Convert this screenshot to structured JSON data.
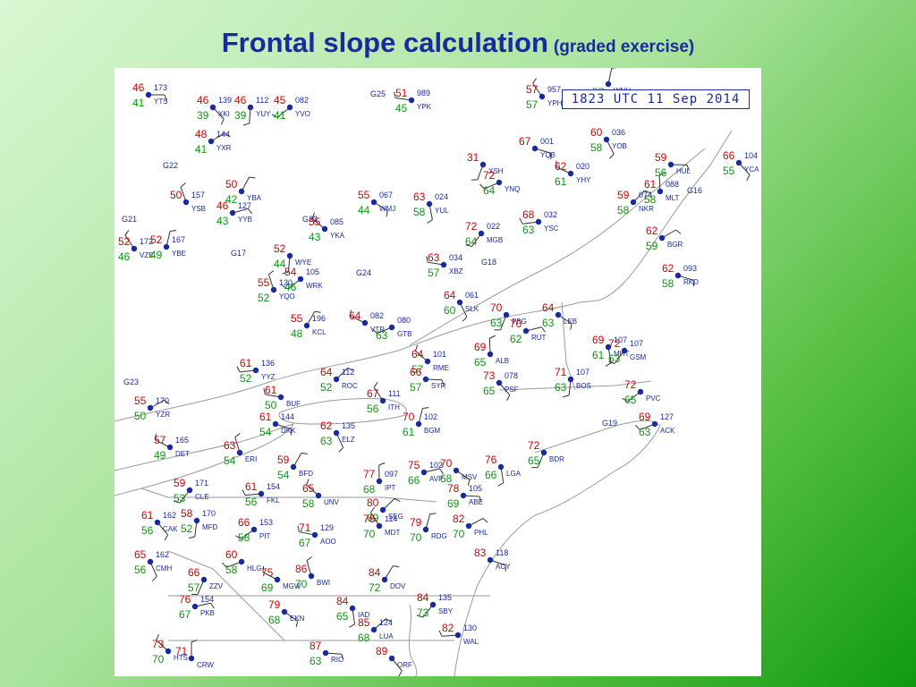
{
  "title": {
    "main": "Frontal slope calculation",
    "sub": "(graded exercise)"
  },
  "map": {
    "timestamp": "1823 UTC 11 Sep 2014",
    "colors": {
      "temperature": "#d40000",
      "dewpoint": "#0a9a0a",
      "station": "#1a2a9c",
      "border": "#9a9a9a",
      "wind": "#333333"
    },
    "stations": [
      {
        "id": "YTS",
        "t": "46",
        "d": "41",
        "pres": "173"
      },
      {
        "id": "XKI",
        "t": "46",
        "d": "39",
        "pres": "139"
      },
      {
        "id": "YUY",
        "t": "46",
        "d": "39",
        "pres": "112"
      },
      {
        "id": "YVO",
        "t": "45",
        "d": "41",
        "pres": "082"
      },
      {
        "id": "YPK",
        "t": "51",
        "d": "45",
        "pres": "989"
      },
      {
        "id": "YPH",
        "t": "57",
        "d": "57",
        "pres": "957"
      },
      {
        "id": "WNH",
        "t": "",
        "d": "57",
        "pres": ""
      },
      {
        "id": "YXR",
        "t": "48",
        "d": "41",
        "pres": "144"
      },
      {
        "id": "YQB",
        "t": "67",
        "d": "",
        "pres": "001"
      },
      {
        "id": "YOB",
        "t": "60",
        "d": "58",
        "pres": "036"
      },
      {
        "id": "XSH",
        "t": "31",
        "d": "",
        "pres": ""
      },
      {
        "id": "YNQ",
        "t": "72",
        "d": "64",
        "pres": ""
      },
      {
        "id": "YHY",
        "t": "62",
        "d": "61",
        "pres": "020"
      },
      {
        "id": "YSB",
        "t": "50",
        "d": "",
        "pres": "157"
      },
      {
        "id": "YBA",
        "t": "50",
        "d": "42",
        "pres": ""
      },
      {
        "id": "YYB",
        "t": "46",
        "d": "43",
        "pres": "127"
      },
      {
        "id": "WMJ",
        "t": "55",
        "d": "44",
        "pres": "067"
      },
      {
        "id": "YUL",
        "t": "63",
        "d": "58",
        "pres": "024"
      },
      {
        "id": "MGB",
        "t": "72",
        "d": "64",
        "pres": "022"
      },
      {
        "id": "YSC",
        "t": "68",
        "d": "63",
        "pres": "032"
      },
      {
        "id": "YKA",
        "t": "55",
        "d": "43",
        "pres": "085"
      },
      {
        "id": "MLT",
        "t": "61",
        "d": "58",
        "pres": "088"
      },
      {
        "id": "NKR",
        "t": "59",
        "d": "58",
        "pres": "074"
      },
      {
        "id": "HUL",
        "t": "59",
        "d": "56",
        "pres": ""
      },
      {
        "id": "YCA",
        "t": "66",
        "d": "55",
        "pres": "104"
      },
      {
        "id": "WYE",
        "t": "52",
        "d": "44",
        "pres": ""
      },
      {
        "id": "WRK",
        "t": "54",
        "d": "46",
        "pres": "105"
      },
      {
        "id": "XBZ",
        "t": "63",
        "d": "57",
        "pres": "034"
      },
      {
        "id": "VZE",
        "t": "52",
        "d": "46",
        "pres": "172"
      },
      {
        "id": "YBE",
        "t": "52",
        "d": "49",
        "pres": "167"
      },
      {
        "id": "BGR",
        "t": "62",
        "d": "59",
        "pres": ""
      },
      {
        "id": "RKD",
        "t": "62",
        "d": "58",
        "pres": "093"
      },
      {
        "id": "SLK",
        "t": "64",
        "d": "60",
        "pres": "061"
      },
      {
        "id": "PBG",
        "t": "70",
        "d": "63",
        "pres": ""
      },
      {
        "id": "GTB",
        "t": "",
        "d": "63",
        "pres": "080"
      },
      {
        "id": "VTR",
        "t": "64",
        "d": "",
        "pres": "082"
      },
      {
        "id": "YQO",
        "t": "55",
        "d": "52",
        "pres": "130"
      },
      {
        "id": "KCL",
        "t": "55",
        "d": "48",
        "pres": "196"
      },
      {
        "id": "RUT",
        "t": "70",
        "d": "62",
        "pres": ""
      },
      {
        "id": "LEB",
        "t": "64",
        "d": "63",
        "pres": ""
      },
      {
        "id": "MHT",
        "t": "69",
        "d": "61",
        "pres": "107"
      },
      {
        "id": "GSM",
        "t": "72",
        "d": "63",
        "pres": "107"
      },
      {
        "id": "YYZ",
        "t": "61",
        "d": "52",
        "pres": "136"
      },
      {
        "id": "RME",
        "t": "64",
        "d": "57",
        "pres": "101"
      },
      {
        "id": "ALB",
        "t": "69",
        "d": "65",
        "pres": ""
      },
      {
        "id": "ROC",
        "t": "64",
        "d": "52",
        "pres": "112"
      },
      {
        "id": "SYR",
        "t": "66",
        "d": "57",
        "pres": ""
      },
      {
        "id": "PSF",
        "t": "73",
        "d": "65",
        "pres": "078"
      },
      {
        "id": "BOS",
        "t": "71",
        "d": "63",
        "pres": "107"
      },
      {
        "id": "PVC",
        "t": "72",
        "d": "65",
        "pres": ""
      },
      {
        "id": "BUF",
        "t": "61",
        "d": "50",
        "pres": ""
      },
      {
        "id": "ITH",
        "t": "67",
        "d": "56",
        "pres": "111"
      },
      {
        "id": "BGM",
        "t": "70",
        "d": "61",
        "pres": "102"
      },
      {
        "id": "YZR",
        "t": "55",
        "d": "50",
        "pres": "170"
      },
      {
        "id": "DKK",
        "t": "61",
        "d": "54",
        "pres": "144"
      },
      {
        "id": "ELZ",
        "t": "62",
        "d": "63",
        "pres": "135"
      },
      {
        "id": "BDR",
        "t": "72",
        "d": "65",
        "pres": ""
      },
      {
        "id": "ACK",
        "t": "69",
        "d": "63",
        "pres": "127"
      },
      {
        "id": "DET",
        "t": "57",
        "d": "49",
        "pres": "165"
      },
      {
        "id": "ERI",
        "t": "63",
        "d": "54",
        "pres": ""
      },
      {
        "id": "BFD",
        "t": "59",
        "d": "54",
        "pres": ""
      },
      {
        "id": "AVP",
        "t": "75",
        "d": "66",
        "pres": "102"
      },
      {
        "id": "MSV",
        "t": "70",
        "d": "68",
        "pres": ""
      },
      {
        "id": "LGA",
        "t": "76",
        "d": "66",
        "pres": ""
      },
      {
        "id": "CLE",
        "t": "59",
        "d": "53",
        "pres": "171"
      },
      {
        "id": "FKL",
        "t": "61",
        "d": "56",
        "pres": "154"
      },
      {
        "id": "UNV",
        "t": "65",
        "d": "58",
        "pres": ""
      },
      {
        "id": "IPT",
        "t": "77",
        "d": "68",
        "pres": "097"
      },
      {
        "id": "SEG",
        "t": "80",
        "d": "69",
        "pres": ""
      },
      {
        "id": "ABE",
        "t": "78",
        "d": "69",
        "pres": "105"
      },
      {
        "id": "CAK",
        "t": "61",
        "d": "56",
        "pres": "162"
      },
      {
        "id": "MFD",
        "t": "58",
        "d": "52",
        "pres": "170"
      },
      {
        "id": "PIT",
        "t": "66",
        "d": "58",
        "pres": "153"
      },
      {
        "id": "AOO",
        "t": "71",
        "d": "67",
        "pres": "129"
      },
      {
        "id": "MDT",
        "t": "76",
        "d": "70",
        "pres": "114"
      },
      {
        "id": "RDG",
        "t": "79",
        "d": "70",
        "pres": ""
      },
      {
        "id": "PHL",
        "t": "82",
        "d": "70",
        "pres": ""
      },
      {
        "id": "ACY",
        "t": "83",
        "d": "",
        "pres": "118"
      },
      {
        "id": "CMH",
        "t": "65",
        "d": "56",
        "pres": "162"
      },
      {
        "id": "ZZV",
        "t": "66",
        "d": "57",
        "pres": ""
      },
      {
        "id": "HLG",
        "t": "60",
        "d": "58",
        "pres": ""
      },
      {
        "id": "MGW",
        "t": "75",
        "d": "69",
        "pres": ""
      },
      {
        "id": "BWI",
        "t": "86",
        "d": "70",
        "pres": ""
      },
      {
        "id": "DOV",
        "t": "84",
        "d": "72",
        "pres": ""
      },
      {
        "id": "PKB",
        "t": "76",
        "d": "67",
        "pres": "154"
      },
      {
        "id": "EKN",
        "t": "79",
        "d": "68",
        "pres": ""
      },
      {
        "id": "IAD",
        "t": "84",
        "d": "65",
        "pres": ""
      },
      {
        "id": "SBY",
        "t": "84",
        "d": "73",
        "pres": "135"
      },
      {
        "id": "WAL",
        "t": "82",
        "d": "",
        "pres": "130"
      },
      {
        "id": "HTS",
        "t": "73",
        "d": "70",
        "pres": ""
      },
      {
        "id": "CRW",
        "t": "71",
        "d": "",
        "pres": ""
      },
      {
        "id": "LUA",
        "t": "85",
        "d": "68",
        "pres": "124"
      },
      {
        "id": "RIC",
        "t": "87",
        "d": "63",
        "pres": ""
      },
      {
        "id": "ORF",
        "t": "89",
        "d": "",
        "pres": ""
      }
    ],
    "wind_markers": [
      "G21",
      "G22",
      "G17",
      "G25",
      "G16",
      "G18",
      "G24",
      "G19",
      "G23",
      "G33"
    ]
  }
}
